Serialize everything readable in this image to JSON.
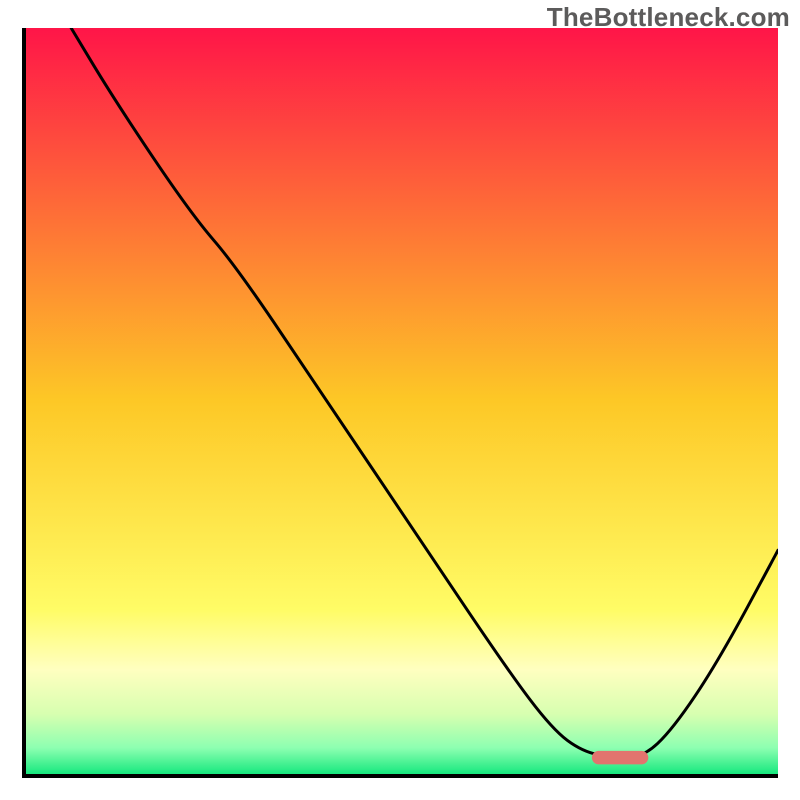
{
  "watermark": "TheBottleneck.com",
  "chart_data": {
    "type": "line",
    "title": "",
    "xlabel": "",
    "ylabel": "",
    "xlim": [
      0,
      100
    ],
    "ylim": [
      0,
      100
    ],
    "grid": false,
    "legend": false,
    "background_gradient": {
      "stops": [
        {
          "offset": 0.0,
          "color": "#ff1548"
        },
        {
          "offset": 0.5,
          "color": "#fdc826"
        },
        {
          "offset": 0.78,
          "color": "#fffc66"
        },
        {
          "offset": 0.86,
          "color": "#ffffc0"
        },
        {
          "offset": 0.92,
          "color": "#d7ffb0"
        },
        {
          "offset": 0.965,
          "color": "#8dffb1"
        },
        {
          "offset": 1.0,
          "color": "#17e87e"
        }
      ]
    },
    "series": [
      {
        "name": "bottleneck-curve",
        "color": "#000000",
        "stroke_width": 3,
        "x": [
          6,
          12,
          22,
          28,
          40,
          52,
          64,
          70,
          74,
          78,
          82,
          86,
          92,
          100
        ],
        "y": [
          100,
          90,
          75,
          68,
          50,
          32,
          14,
          6,
          3,
          2.2,
          2.2,
          6,
          15,
          30
        ]
      }
    ],
    "marker": {
      "name": "optimal-range",
      "shape": "capsule",
      "color": "#e2746e",
      "x_center": 79,
      "y_center": 2.2,
      "width_pct": 7.5,
      "height_pct": 1.8
    }
  }
}
